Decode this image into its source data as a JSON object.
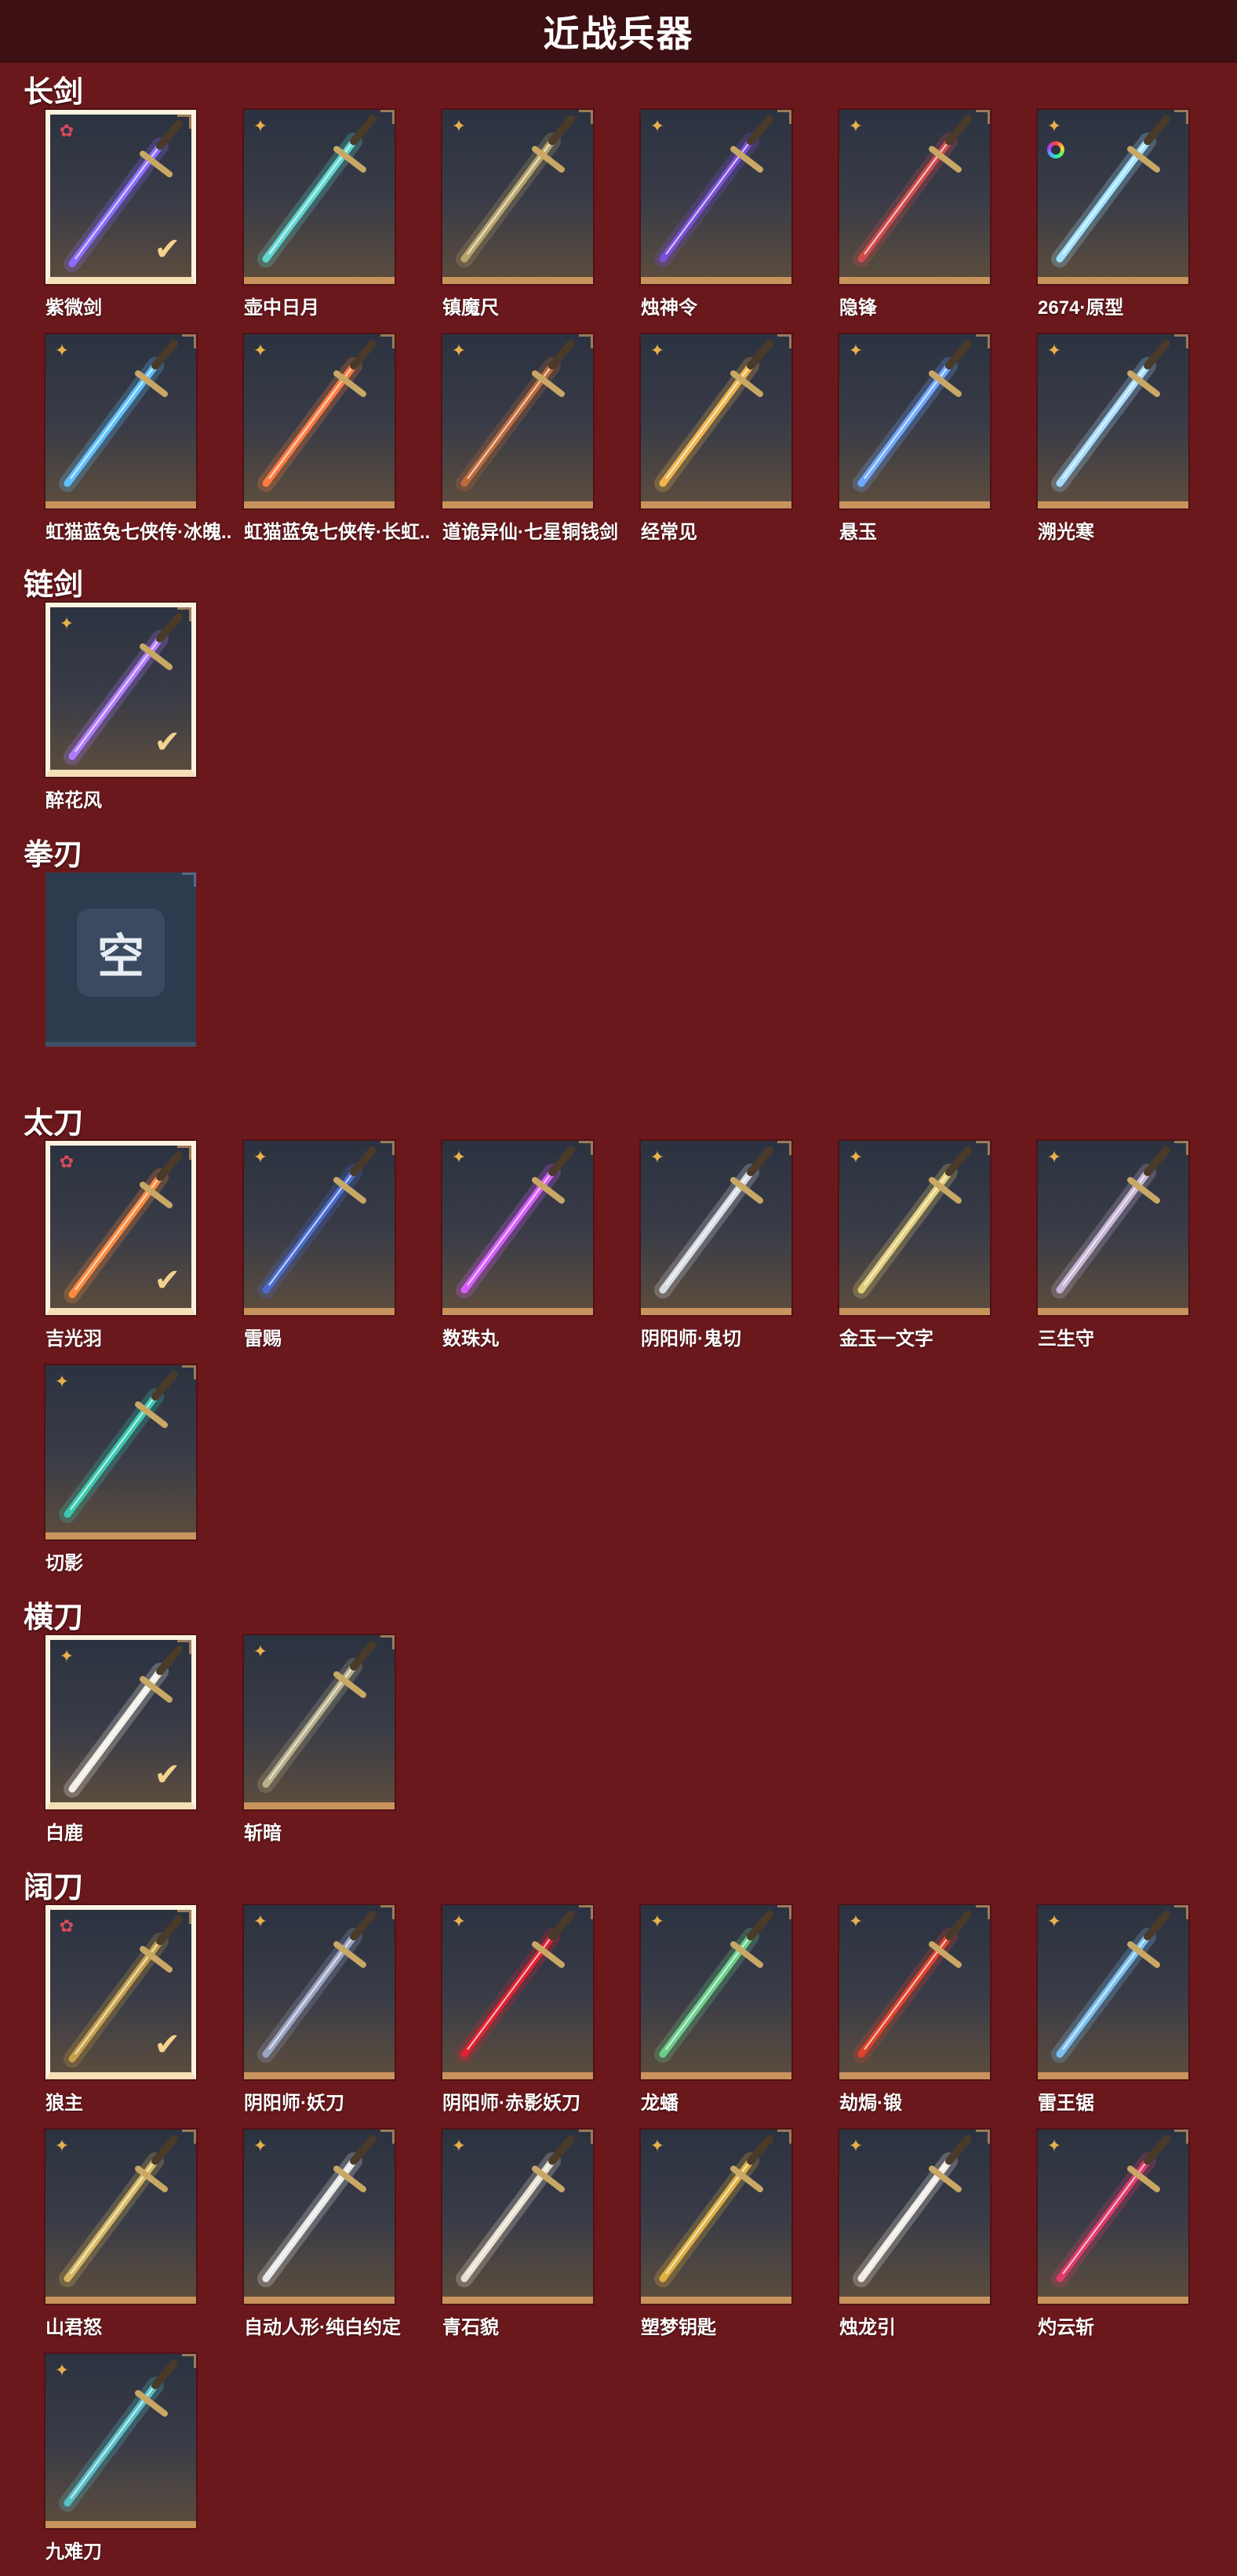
{
  "header": {
    "title": "近战兵器"
  },
  "sections": [
    {
      "id": "changjian",
      "title": "长剑"
    },
    {
      "id": "lianjian",
      "title": "链剑"
    },
    {
      "id": "quanren",
      "title": "拳刃"
    },
    {
      "id": "taidao",
      "title": "太刀"
    },
    {
      "id": "hengdao",
      "title": "横刀"
    },
    {
      "id": "kuodao",
      "title": "阔刀"
    }
  ],
  "empty_slot_label": "空",
  "rank_icons": {
    "gold": "gold-star-icon",
    "red": "red-star-icon"
  },
  "colors": {
    "background": "#6b181c",
    "header": "#3d1013",
    "card_trim": "#c8935c",
    "rank_gold": "#e7b04d",
    "rank_red": "#d94a5b"
  },
  "items": [
    {
      "name": "紫微剑",
      "rank": "red",
      "selected": true,
      "color": "#8a6cff"
    },
    {
      "name": "壶中日月",
      "rank": "gold",
      "selected": false,
      "color": "#5fd6d0"
    },
    {
      "name": "镇魔尺",
      "rank": "gold",
      "selected": false,
      "color": "#b9a46a"
    },
    {
      "name": "烛神令",
      "rank": "gold",
      "selected": false,
      "color": "#7a4ed8"
    },
    {
      "name": "隐锋",
      "rank": "gold",
      "selected": false,
      "color": "#d04a4a"
    },
    {
      "name": "2674·原型",
      "rank": "gold",
      "selected": false,
      "color": "#9fe3ff",
      "rainbow": true
    },
    {
      "name": "虹猫蓝兔七侠传·冰魄..",
      "rank": "gold",
      "selected": false,
      "color": "#5ec0ff"
    },
    {
      "name": "虹猫蓝兔七侠传·长虹..",
      "rank": "gold",
      "selected": false,
      "color": "#ff7a3d"
    },
    {
      "name": "道诡异仙·七星铜钱剑",
      "rank": "gold",
      "selected": false,
      "color": "#c06a3a"
    },
    {
      "name": "经常见",
      "rank": "gold",
      "selected": false,
      "color": "#f0b44a"
    },
    {
      "name": "悬玉",
      "rank": "gold",
      "selected": false,
      "color": "#6fa8ff"
    },
    {
      "name": "溯光寒",
      "rank": "gold",
      "selected": false,
      "color": "#a8dcff"
    },
    {
      "name": "醉花风",
      "rank": "gold",
      "selected": true,
      "color": "#b07aff"
    },
    {
      "name": "吉光羽",
      "rank": "red",
      "selected": true,
      "color": "#ff8a3d"
    },
    {
      "name": "雷赐",
      "rank": "gold",
      "selected": false,
      "color": "#4a6cd0"
    },
    {
      "name": "数珠丸",
      "rank": "gold",
      "selected": false,
      "color": "#d65cff"
    },
    {
      "name": "阴阳师·鬼切",
      "rank": "gold",
      "selected": false,
      "color": "#d8dce4"
    },
    {
      "name": "金玉一文字",
      "rank": "gold",
      "selected": false,
      "color": "#e4cf7a"
    },
    {
      "name": "三生守",
      "rank": "gold",
      "selected": false,
      "color": "#c8b6d8"
    },
    {
      "name": "切影",
      "rank": "gold",
      "selected": false,
      "color": "#3ac8b0"
    },
    {
      "name": "白鹿",
      "rank": "gold",
      "selected": true,
      "color": "#f2efe6"
    },
    {
      "name": "斩暗",
      "rank": "gold",
      "selected": false,
      "color": "#b8b08a"
    },
    {
      "name": "狼主",
      "rank": "red",
      "selected": true,
      "color": "#c8a048"
    },
    {
      "name": "阴阳师·妖刀",
      "rank": "gold",
      "selected": false,
      "color": "#9aa4c4"
    },
    {
      "name": "阴阳师·赤影妖刀",
      "rank": "gold",
      "selected": false,
      "color": "#e02030"
    },
    {
      "name": "龙蟠",
      "rank": "gold",
      "selected": false,
      "color": "#6ad08a"
    },
    {
      "name": "劫焗·锻",
      "rank": "gold",
      "selected": false,
      "color": "#e0402a"
    },
    {
      "name": "雷王锯",
      "rank": "gold",
      "selected": false,
      "color": "#7ac0f0"
    },
    {
      "name": "山君怒",
      "rank": "gold",
      "selected": false,
      "color": "#d8b860"
    },
    {
      "name": "自动人形·纯白约定",
      "rank": "gold",
      "selected": false,
      "color": "#e8e8e8"
    },
    {
      "name": "青石貌",
      "rank": "gold",
      "selected": false,
      "color": "#e8e0d0"
    },
    {
      "name": "塑梦钥匙",
      "rank": "gold",
      "selected": false,
      "color": "#e0b040"
    },
    {
      "name": "烛龙引",
      "rank": "gold",
      "selected": false,
      "color": "#f0ece4"
    },
    {
      "name": "灼云斩",
      "rank": "gold",
      "selected": false,
      "color": "#e03a6a"
    },
    {
      "name": "九难刀",
      "rank": "gold",
      "selected": false,
      "color": "#58c0c8"
    }
  ]
}
